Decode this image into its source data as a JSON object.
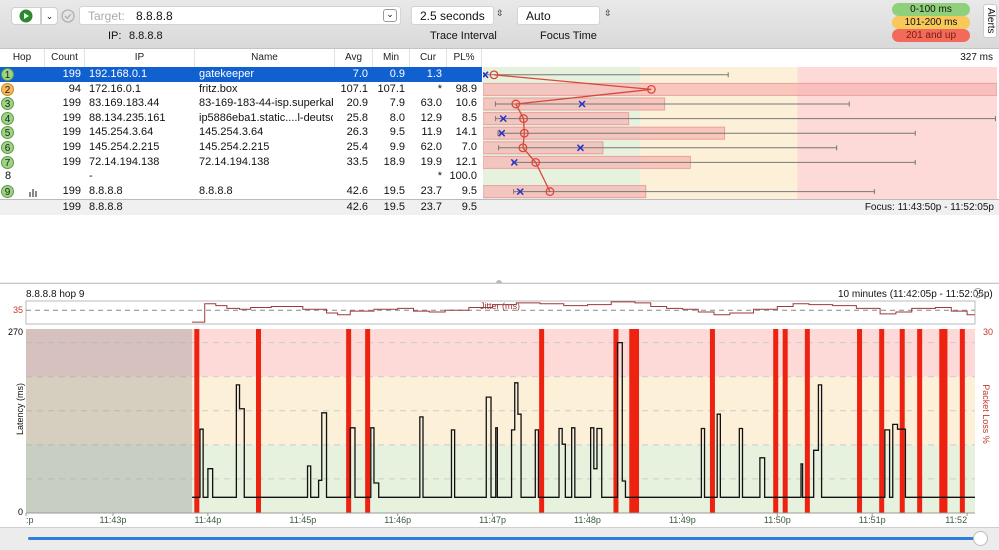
{
  "toolbar": {
    "target_label": "Target:",
    "target_value": "8.8.8.8",
    "ip_label": "IP:",
    "ip_value": "8.8.8.8",
    "trace_interval_value": "2.5 seconds",
    "trace_interval_label": "Trace Interval",
    "focus_time_value": "Auto",
    "focus_time_label": "Focus Time",
    "alerts_tab": "Alerts",
    "legend": [
      {
        "label": "0-100 ms",
        "color": "#8fd17a"
      },
      {
        "label": "101-200 ms",
        "color": "#f7c85a"
      },
      {
        "label": "201 and up",
        "color": "#f26a5a"
      }
    ]
  },
  "table": {
    "columns": [
      "Hop",
      "Count",
      "IP",
      "Name",
      "Avg",
      "Min",
      "Cur",
      "PL%"
    ],
    "graph_max_label": "327 ms",
    "graph_max_ms": 327,
    "graph_pl_scale": 30,
    "rows": [
      {
        "hop": "1",
        "count": "199",
        "ip": "192.168.0.1",
        "name": "gatekeeper",
        "avg": "7.0",
        "min": "0.9",
        "cur": "1.3",
        "pl": "",
        "max_ms": 156,
        "status": "green",
        "selected": true
      },
      {
        "hop": "2",
        "count": "94",
        "ip": "172.16.0.1",
        "name": "fritz.box",
        "avg": "107.1",
        "min": "107.1",
        "cur": "*",
        "pl": "98.9",
        "max_ms": 107.1,
        "status": "orange"
      },
      {
        "hop": "3",
        "count": "199",
        "ip": "83.169.183.44",
        "name": "83-169-183-44-isp.superkabel.de",
        "avg": "20.9",
        "min": "7.9",
        "cur": "63.0",
        "pl": "10.6",
        "max_ms": 233,
        "status": "green"
      },
      {
        "hop": "4",
        "count": "199",
        "ip": "88.134.235.161",
        "name": "ip5886eba1.static....l-deutschland.de",
        "avg": "25.8",
        "min": "8.0",
        "cur": "12.9",
        "pl": "8.5",
        "max_ms": 326,
        "status": "green"
      },
      {
        "hop": "5",
        "count": "199",
        "ip": "145.254.3.64",
        "name": "145.254.3.64",
        "avg": "26.3",
        "min": "9.5",
        "cur": "11.9",
        "pl": "14.1",
        "max_ms": 275,
        "status": "green"
      },
      {
        "hop": "6",
        "count": "199",
        "ip": "145.254.2.215",
        "name": "145.254.2.215",
        "avg": "25.4",
        "min": "9.9",
        "cur": "62.0",
        "pl": "7.0",
        "max_ms": 225,
        "status": "green"
      },
      {
        "hop": "7",
        "count": "199",
        "ip": "72.14.194.138",
        "name": "72.14.194.138",
        "avg": "33.5",
        "min": "18.9",
        "cur": "19.9",
        "pl": "12.1",
        "max_ms": 275,
        "status": "green"
      },
      {
        "hop": "8",
        "count": "",
        "ip": "-",
        "name": "",
        "avg": "",
        "min": "",
        "cur": "*",
        "pl": "100.0",
        "status": "none"
      },
      {
        "hop": "9",
        "count": "199",
        "ip": "8.8.8.8",
        "name": "8.8.8.8",
        "avg": "42.6",
        "min": "19.5",
        "cur": "23.7",
        "pl": "9.5",
        "max_ms": 249,
        "status": "green",
        "graph_icon": "bar-chart-icon"
      }
    ],
    "summary": {
      "count": "199",
      "ip": "8.8.8.8",
      "avg": "42.6",
      "min": "19.5",
      "cur": "23.7",
      "pl": "9.5"
    },
    "focus_label": "Focus: 11:43:50p - 11:52:05p"
  },
  "colors": {
    "green_zone": "#e6f2dd",
    "yellow_zone": "#fdf0d8",
    "red_zone": "#fddad7",
    "selection": "#1160d0",
    "loss": "#ee2211",
    "jitter": "#9a3a3a"
  },
  "chart_data": {
    "type": "line",
    "title": "8.8.8.8 hop 9",
    "range_label": "10 minutes (11:42:05p - 11:52:05p)",
    "ylabel": "Latency (ms)",
    "y2label": "Packet Loss %",
    "ylim": [
      0,
      270
    ],
    "y2lim": [
      0,
      30
    ],
    "ytick_labels": [
      "270",
      "0"
    ],
    "y2tick_labels": [
      "30"
    ],
    "xlim": [
      "11:42:05",
      "11:52:05"
    ],
    "xtick_labels": [
      ":p",
      "11:43p",
      "11:44p",
      "11:45p",
      "11:46p",
      "11:47p",
      "11:48p",
      "11:49p",
      "11:50p",
      "11:51p",
      "11:52"
    ],
    "xticks": [
      "11:42:05",
      "11:43:00",
      "11:44:00",
      "11:45:00",
      "11:46:00",
      "11:47:00",
      "11:48:00",
      "11:49:00",
      "11:50:00",
      "11:51:00",
      "11:52:00"
    ],
    "no_data_until": "11:43:50",
    "zones_ms": [
      100,
      200
    ],
    "grid": true,
    "jitter": {
      "label": "Jitter (ms)",
      "reference": "35",
      "reference_ms": 35,
      "ylim": [
        20,
        45
      ],
      "points": [
        [
          "11:43:50",
          22
        ],
        [
          "11:43:57",
          22
        ],
        [
          "11:43:58",
          42
        ],
        [
          "11:44:05",
          40
        ],
        [
          "11:44:12",
          37
        ],
        [
          "11:44:20",
          36
        ],
        [
          "11:44:27",
          38
        ],
        [
          "11:44:40",
          39
        ],
        [
          "11:45:00",
          36
        ],
        [
          "11:45:15",
          32
        ],
        [
          "11:45:22",
          30
        ],
        [
          "11:45:30",
          34
        ],
        [
          "11:45:45",
          36
        ],
        [
          "11:46:00",
          37
        ],
        [
          "11:46:10",
          34
        ],
        [
          "11:46:20",
          33
        ],
        [
          "11:46:30",
          35
        ],
        [
          "11:46:45",
          38
        ],
        [
          "11:47:00",
          41
        ],
        [
          "11:47:15",
          43
        ],
        [
          "11:47:30",
          42
        ],
        [
          "11:47:45",
          40
        ],
        [
          "11:48:00",
          41
        ],
        [
          "11:48:15",
          44
        ],
        [
          "11:48:30",
          43
        ],
        [
          "11:48:40",
          39
        ],
        [
          "11:48:50",
          37
        ],
        [
          "11:49:00",
          36
        ],
        [
          "11:49:10",
          33
        ],
        [
          "11:49:20",
          30
        ],
        [
          "11:49:30",
          32
        ],
        [
          "11:49:45",
          36
        ],
        [
          "11:50:00",
          39
        ],
        [
          "11:50:10",
          42
        ],
        [
          "11:50:20",
          41
        ],
        [
          "11:50:35",
          40
        ],
        [
          "11:50:50",
          37
        ],
        [
          "11:51:05",
          31
        ],
        [
          "11:51:15",
          33
        ],
        [
          "11:51:25",
          37
        ],
        [
          "11:51:40",
          38
        ],
        [
          "11:51:50",
          34
        ],
        [
          "11:52:00",
          30
        ],
        [
          "11:52:05",
          30
        ]
      ]
    },
    "latency": [
      [
        "11:43:50",
        23
      ],
      [
        "11:43:55",
        123
      ],
      [
        "11:43:57",
        23
      ],
      [
        "11:44:00",
        65
      ],
      [
        "11:44:03",
        23
      ],
      [
        "11:44:18",
        188
      ],
      [
        "11:44:20",
        153
      ],
      [
        "11:44:23",
        23
      ],
      [
        "11:45:03",
        69
      ],
      [
        "11:45:05",
        23
      ],
      [
        "11:45:10",
        48
      ],
      [
        "11:45:12",
        147
      ],
      [
        "11:45:15",
        23
      ],
      [
        "11:45:30",
        125
      ],
      [
        "11:45:33",
        23
      ],
      [
        "11:45:43",
        125
      ],
      [
        "11:45:45",
        44
      ],
      [
        "11:45:48",
        23
      ],
      [
        "11:46:14",
        141
      ],
      [
        "11:46:16",
        23
      ],
      [
        "11:46:34",
        122
      ],
      [
        "11:46:36",
        23
      ],
      [
        "11:46:56",
        170
      ],
      [
        "11:46:59",
        23
      ],
      [
        "11:47:02",
        125
      ],
      [
        "11:47:03",
        23
      ],
      [
        "11:47:12",
        122
      ],
      [
        "11:47:14",
        191
      ],
      [
        "11:47:16",
        145
      ],
      [
        "11:47:18",
        23
      ],
      [
        "11:47:27",
        122
      ],
      [
        "11:47:29",
        23
      ],
      [
        "11:47:42",
        124
      ],
      [
        "11:47:44",
        101
      ],
      [
        "11:47:46",
        23
      ],
      [
        "11:47:50",
        125
      ],
      [
        "11:47:52",
        23
      ],
      [
        "11:48:02",
        125
      ],
      [
        "11:48:04",
        65
      ],
      [
        "11:48:06",
        124
      ],
      [
        "11:48:09",
        23
      ],
      [
        "11:48:19",
        250
      ],
      [
        "11:48:22",
        47
      ],
      [
        "11:48:24",
        23
      ],
      [
        "11:49:12",
        124
      ],
      [
        "11:49:14",
        23
      ],
      [
        "11:49:22",
        145
      ],
      [
        "11:49:24",
        23
      ],
      [
        "11:49:36",
        124
      ],
      [
        "11:49:38",
        23
      ],
      [
        "11:49:49",
        81
      ],
      [
        "11:49:52",
        23
      ],
      [
        "11:50:15",
        72
      ],
      [
        "11:50:16",
        23
      ],
      [
        "11:50:23",
        92
      ],
      [
        "11:50:26",
        188
      ],
      [
        "11:50:28",
        23
      ],
      [
        "11:51:08",
        122
      ],
      [
        "11:51:11",
        23
      ],
      [
        "11:51:13",
        130
      ],
      [
        "11:51:16",
        123
      ],
      [
        "11:51:21",
        23
      ],
      [
        "11:52:05",
        23
      ]
    ],
    "packet_loss": [
      [
        "11:43:53",
        30
      ],
      [
        "11:44:32",
        30
      ],
      [
        "11:45:29",
        30
      ],
      [
        "11:45:41",
        30
      ],
      [
        "11:47:31",
        30
      ],
      [
        "11:48:18",
        30
      ],
      [
        "11:48:28",
        30
      ],
      [
        "11:48:31",
        30
      ],
      [
        "11:49:19",
        30
      ],
      [
        "11:49:59",
        30
      ],
      [
        "11:50:05",
        30
      ],
      [
        "11:50:19",
        30
      ],
      [
        "11:50:52",
        30
      ],
      [
        "11:51:06",
        30
      ],
      [
        "11:51:19",
        30
      ],
      [
        "11:51:30",
        30
      ],
      [
        "11:51:44",
        30
      ],
      [
        "11:51:46",
        30
      ],
      [
        "11:51:57",
        30
      ]
    ]
  }
}
